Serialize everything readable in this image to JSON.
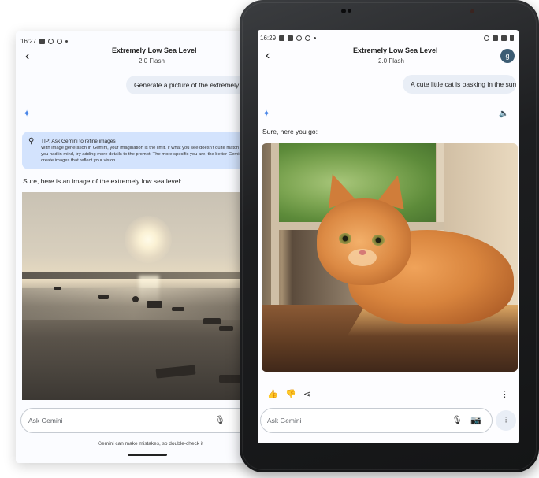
{
  "back_device": {
    "status_time": "16:27",
    "title": "Extremely Low Sea Level",
    "subtitle": "2.0 Flash",
    "user_prompt": "Generate a picture of the extremely lo",
    "tip_title": "TIP: Ask Gemini to refine images",
    "tip_body": "With image generation in Gemini, your imagination is the limit. If what you see doesn't quite match what you had in mind, try adding more details to the prompt. The more specific you are, the better Gemini can create images that reflect your vision.",
    "reply": "Sure, here is an image of the extremely low sea level:",
    "input_placeholder": "Ask Gemini",
    "disclaimer": "Gemini can make mistakes, so double-check it"
  },
  "front_device": {
    "status_time": "16:29",
    "title": "Extremely Low Sea Level",
    "subtitle": "2.0 Flash",
    "avatar_initial": "g",
    "user_prompt": "A cute little cat is basking in the sun.",
    "reply": "Sure, here you go:",
    "input_placeholder": "Ask Gemini"
  },
  "icons": {
    "back": "arrow-left-icon",
    "sparkle": "gemini-sparkle-icon",
    "tip": "lightbulb-icon",
    "speaker": "speaker-icon",
    "thumbs_up": "thumbs-up-icon",
    "thumbs_down": "thumbs-down-icon",
    "share": "share-icon",
    "more": "more-vertical-icon",
    "mic": "microphone-icon",
    "camera": "camera-icon",
    "live": "live-waveform-icon"
  },
  "colors": {
    "bubble": "#e9eef6",
    "tip_card": "#d3e3fd",
    "sparkle": "#4a86e8",
    "avatar": "#3c5c73",
    "frame": "#1d1e20"
  }
}
